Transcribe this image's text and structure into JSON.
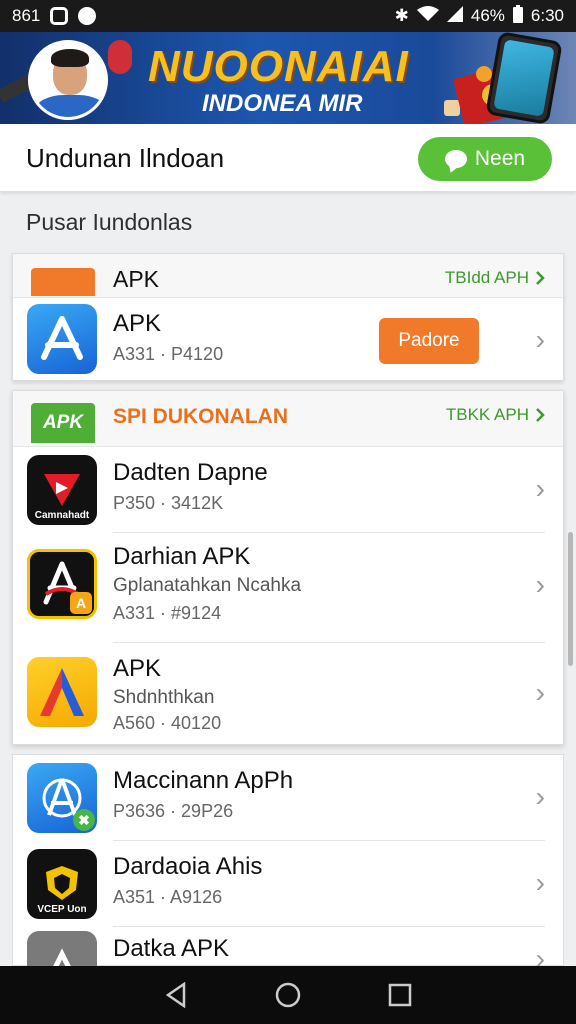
{
  "status_bar": {
    "left_text": "861",
    "battery": "46%",
    "time": "6:30"
  },
  "banner": {
    "title": "NUOONAIAI",
    "subtitle": "INDONEA MIR"
  },
  "app_bar": {
    "title": "Undunan Ilndoan",
    "new_button_label": "Neen"
  },
  "section_label": "Pusar Iundonlas",
  "featured": {
    "header_title": "APK",
    "header_more": "TBIdd APH",
    "app": {
      "name": "APK",
      "meta": "A331 · P4120",
      "button_label": "Padore"
    }
  },
  "popular": {
    "header_badge": "APK",
    "header_title": "SPI DUKONALAN",
    "header_more": "TBKK APH",
    "apps": [
      {
        "name": "Dadten Dapne",
        "sub": "",
        "meta": "P350 · 3412K",
        "icon_tag": "Camnahadt"
      },
      {
        "name": "Darhian APK",
        "sub": "Gplanatahkan Ncahka",
        "meta": "A331 · #9124",
        "icon_tag": "A"
      },
      {
        "name": "APK",
        "sub": "Shdnhthkan",
        "meta": "A560 · 40120",
        "icon_tag": ""
      }
    ]
  },
  "more_apps": [
    {
      "name": "Maccinann ApPh",
      "meta": "P3636 · 29P26"
    },
    {
      "name": "Dardaoia Ahis",
      "meta": "A351 · A9126",
      "icon_tag": "VCEP Uon"
    },
    {
      "name": "Datka APK",
      "meta": ""
    }
  ],
  "colors": {
    "accent_green": "#59c038",
    "accent_orange": "#f07a2a",
    "banner_blue": "#1d57b0"
  }
}
